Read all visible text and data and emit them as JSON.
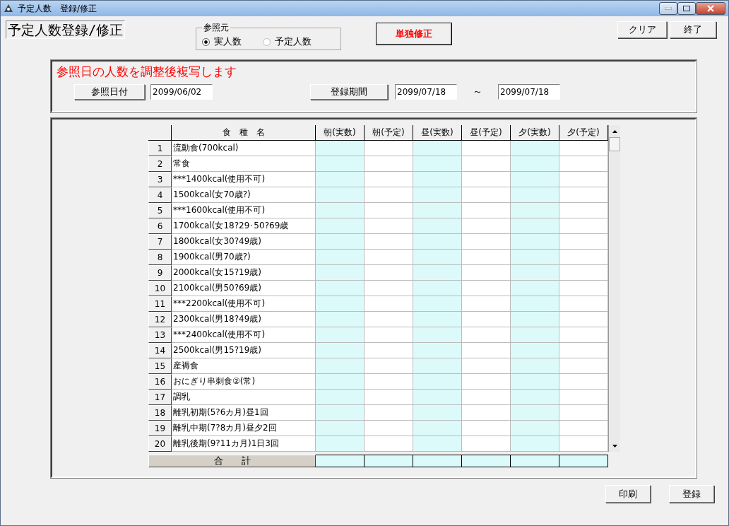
{
  "window": {
    "title": "予定人数　登録/修正"
  },
  "form_title": "予定人数登録/修正",
  "reference_source": {
    "legend": "参照元",
    "options": [
      {
        "label": "実人数",
        "selected": true
      },
      {
        "label": "予定人数",
        "selected": false
      }
    ]
  },
  "single_edit_button": "単独修正",
  "top_buttons": [
    "クリア",
    "終了"
  ],
  "copy_panel": {
    "message": "参照日の人数を調整後複写します",
    "ref_date_button": "参照日付",
    "ref_date": "2099/06/02",
    "period_button": "登録期間",
    "period_from": "2099/07/18",
    "tilde": "～",
    "period_to": "2099/07/18"
  },
  "table": {
    "name_column": "食　種　名",
    "columns": [
      {
        "label": "朝(実数)",
        "kind": "actual"
      },
      {
        "label": "朝(予定)",
        "kind": "planned"
      },
      {
        "label": "昼(実数)",
        "kind": "actual"
      },
      {
        "label": "昼(予定)",
        "kind": "planned"
      },
      {
        "label": "夕(実数)",
        "kind": "actual"
      },
      {
        "label": "夕(予定)",
        "kind": "planned"
      }
    ],
    "rows": [
      {
        "no": "1",
        "name": "流動食(700kcal)"
      },
      {
        "no": "2",
        "name": "常食"
      },
      {
        "no": "3",
        "name": "***1400kcal(使用不可)"
      },
      {
        "no": "4",
        "name": "1500kcal(女70歳?)"
      },
      {
        "no": "5",
        "name": "***1600kcal(使用不可)"
      },
      {
        "no": "6",
        "name": "1700kcal(女18?29･50?69歳"
      },
      {
        "no": "7",
        "name": "1800kcal(女30?49歳)"
      },
      {
        "no": "8",
        "name": "1900kcal(男70歳?)"
      },
      {
        "no": "9",
        "name": "2000kcal(女15?19歳)"
      },
      {
        "no": "10",
        "name": "2100kcal(男50?69歳)"
      },
      {
        "no": "11",
        "name": "***2200kcal(使用不可)"
      },
      {
        "no": "12",
        "name": "2300kcal(男18?49歳)"
      },
      {
        "no": "13",
        "name": "***2400kcal(使用不可)"
      },
      {
        "no": "14",
        "name": "2500kcal(男15?19歳)"
      },
      {
        "no": "15",
        "name": "産褥食"
      },
      {
        "no": "16",
        "name": "おにぎり串刺食②(常)"
      },
      {
        "no": "17",
        "name": "調乳"
      },
      {
        "no": "18",
        "name": "離乳初期(5?6カ月)昼1回"
      },
      {
        "no": "19",
        "name": "離乳中期(7?8カ月)昼夕2回"
      },
      {
        "no": "20",
        "name": "離乳後期(9?11カ月)1日3回"
      }
    ],
    "total_label": "合　　計"
  },
  "bottom_buttons": [
    "印刷",
    "登録"
  ]
}
